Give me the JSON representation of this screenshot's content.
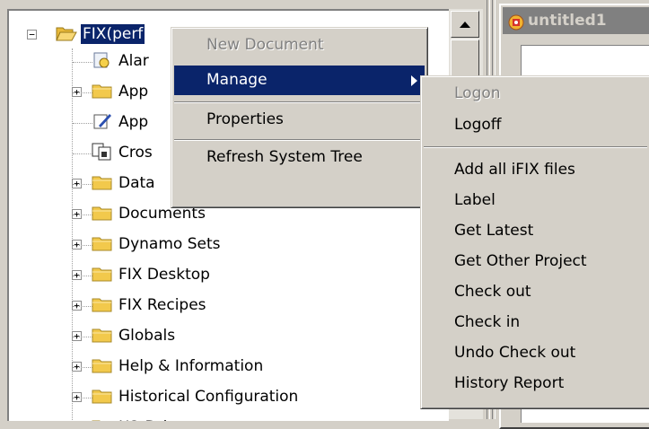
{
  "tree": {
    "root_label": "FIX(perf",
    "rows": [
      {
        "label": "Alar",
        "icon": "alarm-icon"
      },
      {
        "label": "App",
        "icon": "folder-icon"
      },
      {
        "label": "App",
        "icon": "edit-icon"
      },
      {
        "label": "Cros",
        "icon": "cross-reference-icon"
      },
      {
        "label": "Data",
        "icon": "folder-icon"
      },
      {
        "label": "Documents",
        "icon": "folder-icon"
      },
      {
        "label": "Dynamo Sets",
        "icon": "folder-icon"
      },
      {
        "label": "FIX Desktop",
        "icon": "folder-icon"
      },
      {
        "label": "FIX Recipes",
        "icon": "folder-icon"
      },
      {
        "label": "Globals",
        "icon": "folder-icon"
      },
      {
        "label": "Help & Information",
        "icon": "folder-icon"
      },
      {
        "label": "Historical Configuration",
        "icon": "folder-icon"
      },
      {
        "label": "I/O Drivers",
        "icon": "folder-icon"
      }
    ]
  },
  "document_window": {
    "title": "untitled1"
  },
  "context_menu": {
    "new_document": "New Document",
    "manage": "Manage",
    "properties": "Properties",
    "refresh": "Refresh System Tree"
  },
  "manage_submenu": {
    "logon": "Logon",
    "logoff": "Logoff",
    "items": [
      "Add all iFIX files",
      "Label",
      "Get Latest",
      "Get Other Project",
      "Check out",
      "Check in",
      "Undo Check out",
      "History Report"
    ]
  },
  "colors": {
    "selection": "#0a246a",
    "menu_face": "#d4d0c8",
    "folder": "#f2c94c"
  }
}
